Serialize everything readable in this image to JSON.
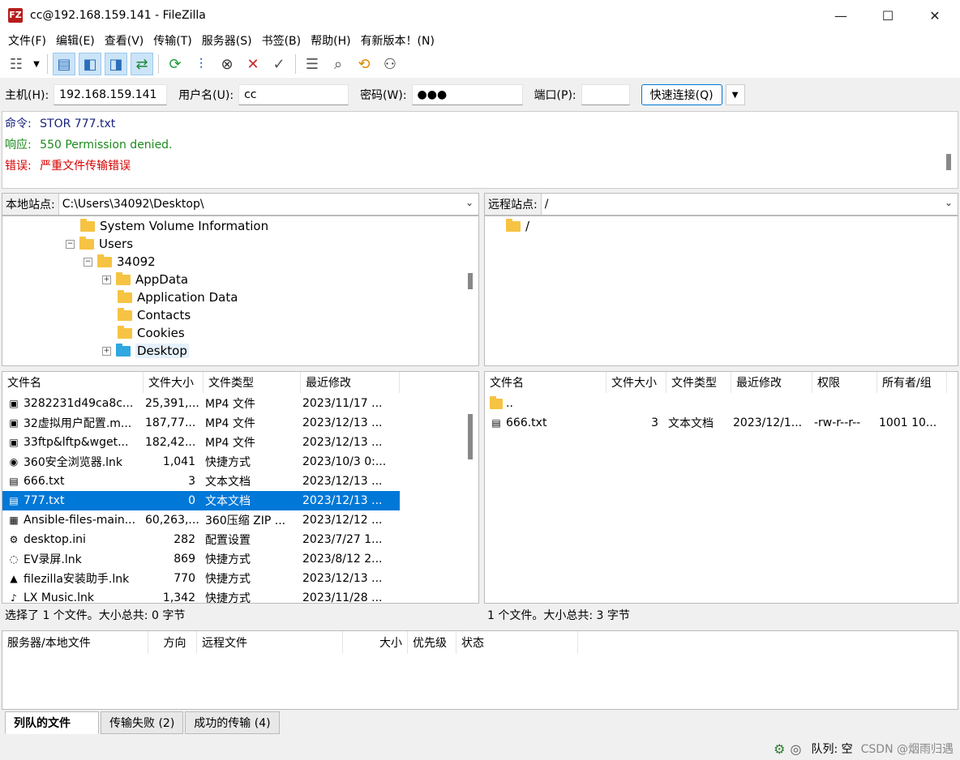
{
  "window": {
    "title": "cc@192.168.159.141 - FileZilla",
    "app_icon": "FZ",
    "minimize": "—",
    "maximize": "☐",
    "close": "✕"
  },
  "menu": [
    "文件(F)",
    "编辑(E)",
    "查看(V)",
    "传输(T)",
    "服务器(S)",
    "书签(B)",
    "帮助(H)",
    "有新版本！(N)"
  ],
  "quickconnect": {
    "host_label": "主机(H):",
    "host_value": "192.168.159.141",
    "user_label": "用户名(U):",
    "user_value": "cc",
    "pass_label": "密码(W):",
    "pass_value": "●●●",
    "port_label": "端口(P):",
    "port_value": "",
    "connect_button": "快速连接(Q)"
  },
  "log": [
    {
      "prefix": "命令:",
      "text": "STOR 777.txt",
      "color": "#1a237e"
    },
    {
      "prefix": "响应:",
      "text": "550 Permission denied.",
      "color": "#1b8a1b"
    },
    {
      "prefix": "错误:",
      "text": "严重文件传输错误",
      "color": "#d50000"
    }
  ],
  "local": {
    "site_label": "本地站点:",
    "site_path": "C:\\Users\\34092\\Desktop\\",
    "tree": [
      {
        "label": "System Volume Information"
      },
      {
        "label": "Users",
        "expander": "−"
      },
      {
        "label": "34092",
        "expander": "−"
      },
      {
        "label": "AppData",
        "expander": "+"
      },
      {
        "label": "Application Data"
      },
      {
        "label": "Contacts"
      },
      {
        "label": "Cookies"
      },
      {
        "label": "Desktop",
        "expander": "+"
      }
    ],
    "columns": [
      "文件名",
      "文件大小",
      "文件类型",
      "最近修改"
    ],
    "files": [
      {
        "name": "3282231d49ca8c...",
        "size": "25,391,...",
        "type": "MP4 文件",
        "modified": "2023/11/17 ...",
        "icon": "▣"
      },
      {
        "name": "32虚拟用户配置.m...",
        "size": "187,77...",
        "type": "MP4 文件",
        "modified": "2023/12/13 ...",
        "icon": "▣"
      },
      {
        "name": "33ftp&lftp&wget...",
        "size": "182,42...",
        "type": "MP4 文件",
        "modified": "2023/12/13 ...",
        "icon": "▣"
      },
      {
        "name": "360安全浏览器.lnk",
        "size": "1,041",
        "type": "快捷方式",
        "modified": "2023/10/3 0:...",
        "icon": "◉"
      },
      {
        "name": "666.txt",
        "size": "3",
        "type": "文本文档",
        "modified": "2023/12/13 ...",
        "icon": "▤"
      },
      {
        "name": "777.txt",
        "size": "0",
        "type": "文本文档",
        "modified": "2023/12/13 ...",
        "icon": "▤",
        "selected": true
      },
      {
        "name": "Ansible-files-main...",
        "size": "60,263,...",
        "type": "360压缩 ZIP ...",
        "modified": "2023/12/12 ...",
        "icon": "▦"
      },
      {
        "name": "desktop.ini",
        "size": "282",
        "type": "配置设置",
        "modified": "2023/7/27 1...",
        "icon": "⚙"
      },
      {
        "name": "EV录屏.lnk",
        "size": "869",
        "type": "快捷方式",
        "modified": "2023/8/12 2...",
        "icon": "◌"
      },
      {
        "name": "filezilla安装助手.lnk",
        "size": "770",
        "type": "快捷方式",
        "modified": "2023/12/13 ...",
        "icon": "▲"
      },
      {
        "name": "LX Music.lnk",
        "size": "1,342",
        "type": "快捷方式",
        "modified": "2023/11/28 ...",
        "icon": "♪"
      }
    ],
    "status": "选择了 1 个文件。大小总共: 0 字节"
  },
  "remote": {
    "site_label": "远程站点:",
    "site_path": "/",
    "tree_root": "/",
    "columns": [
      "文件名",
      "文件大小",
      "文件类型",
      "最近修改",
      "权限",
      "所有者/组"
    ],
    "files": [
      {
        "name": "..",
        "size": "",
        "type": "",
        "modified": "",
        "perm": "",
        "owner": "",
        "icon": "folder"
      },
      {
        "name": "666.txt",
        "size": "3",
        "type": "文本文档",
        "modified": "2023/12/1...",
        "perm": "-rw-r--r--",
        "owner": "1001 10...",
        "icon": "▤"
      }
    ],
    "status": "1 个文件。大小总共: 3 字节"
  },
  "queue": {
    "columns": [
      "服务器/本地文件",
      "方向",
      "远程文件",
      "大小",
      "优先级",
      "状态"
    ],
    "tabs": [
      "列队的文件",
      "传输失败 (2)",
      "成功的传输 (4)"
    ]
  },
  "bottom_status": {
    "queue": "队列: 空",
    "watermark": "CSDN @烟雨归遇"
  }
}
